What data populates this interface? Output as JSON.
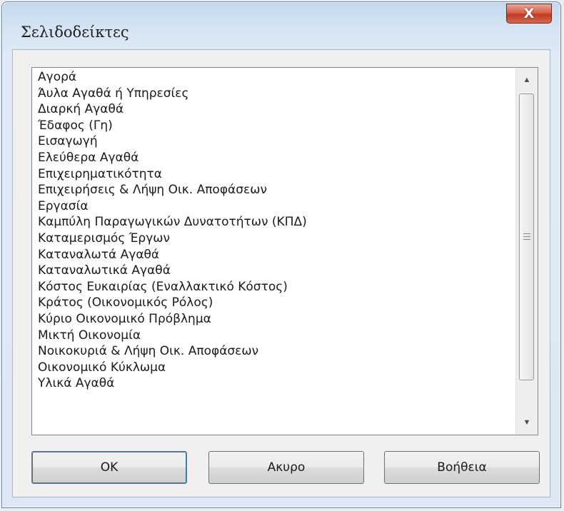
{
  "window": {
    "title": "Σελιδοδείκτες",
    "close_label": "X"
  },
  "list": {
    "items": [
      "Αγορά",
      "Άυλα Αγαθά ή Υπηρεσίες",
      "Διαρκή Αγαθά",
      "Έδαφος (Γη)",
      "Εισαγωγή",
      "Ελεύθερα Αγαθά",
      "Επιχειρηματικότητα",
      "Επιχειρήσεις & Λήψη Οικ. Αποφάσεων",
      "Εργασία",
      "Καμπύλη Παραγωγικών Δυνατοτήτων (ΚΠΔ)",
      "Καταμερισμός Έργων",
      "Καταναλωτά Αγαθά",
      "Καταναλωτικά Αγαθά",
      "Κόστος Ευκαιρίας (Εναλλακτικό Κόστος)",
      "Κράτος (Οικονομικός Ρόλος)",
      "Κύριο Οικονομικό Πρόβλημα",
      "Μικτή Οικονομία",
      "Νοικοκυριά & Λήψη Οικ. Αποφάσεων",
      "Οικονομικό Κύκλωμα",
      "Υλικά Αγαθά"
    ]
  },
  "buttons": {
    "ok": "OK",
    "cancel": "Ακυρο",
    "help": "Βοήθεια"
  }
}
